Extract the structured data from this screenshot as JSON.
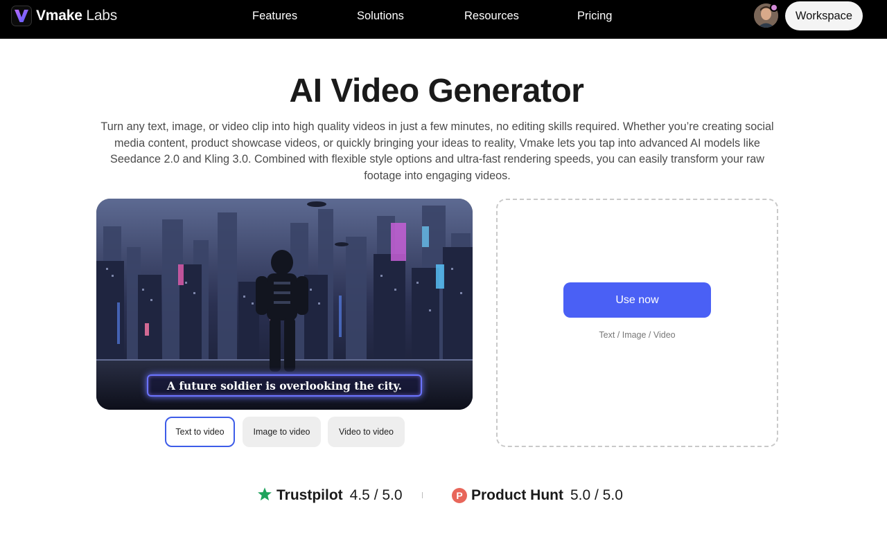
{
  "header": {
    "brand_bold": "Vmake",
    "brand_light": " Labs",
    "nav": [
      "Features",
      "Solutions",
      "Resources",
      "Pricing"
    ],
    "workspace_label": "Workspace",
    "icons": [
      "vmake-logo-icon",
      "avatar-icon"
    ]
  },
  "hero": {
    "title": "AI Video Generator",
    "description": "Turn any text, image, or video clip into high quality videos in just a few minutes, no editing skills required. Whether you’re creating social media content, product showcase videos, or quickly bringing your ideas to reality, Vmake lets you tap into advanced AI models like Seedance 2.0 and Kling 3.0. Combined with flexible style options and ultra-fast rendering speeds, you can easily transform your raw footage into engaging videos."
  },
  "preview": {
    "caption": "A future soldier is overlooking the city."
  },
  "modes": {
    "active": "Text to video",
    "tabs": [
      "Text to video",
      "Image to video",
      "Video to video"
    ]
  },
  "upload": {
    "button_label": "Use now",
    "hint": "Text / Image / Video"
  },
  "ratings": {
    "trustpilot_name": "Trustpilot",
    "trustpilot_score": "4.5 / 5.0",
    "producthunt_name": "Product Hunt",
    "producthunt_score": "5.0 / 5.0",
    "producthunt_badge": "P"
  },
  "colors": {
    "accent": "#4a60f5",
    "topbar": "#000000",
    "trustpilot_star": "#1fa35c",
    "producthunt": "#e8665a"
  }
}
